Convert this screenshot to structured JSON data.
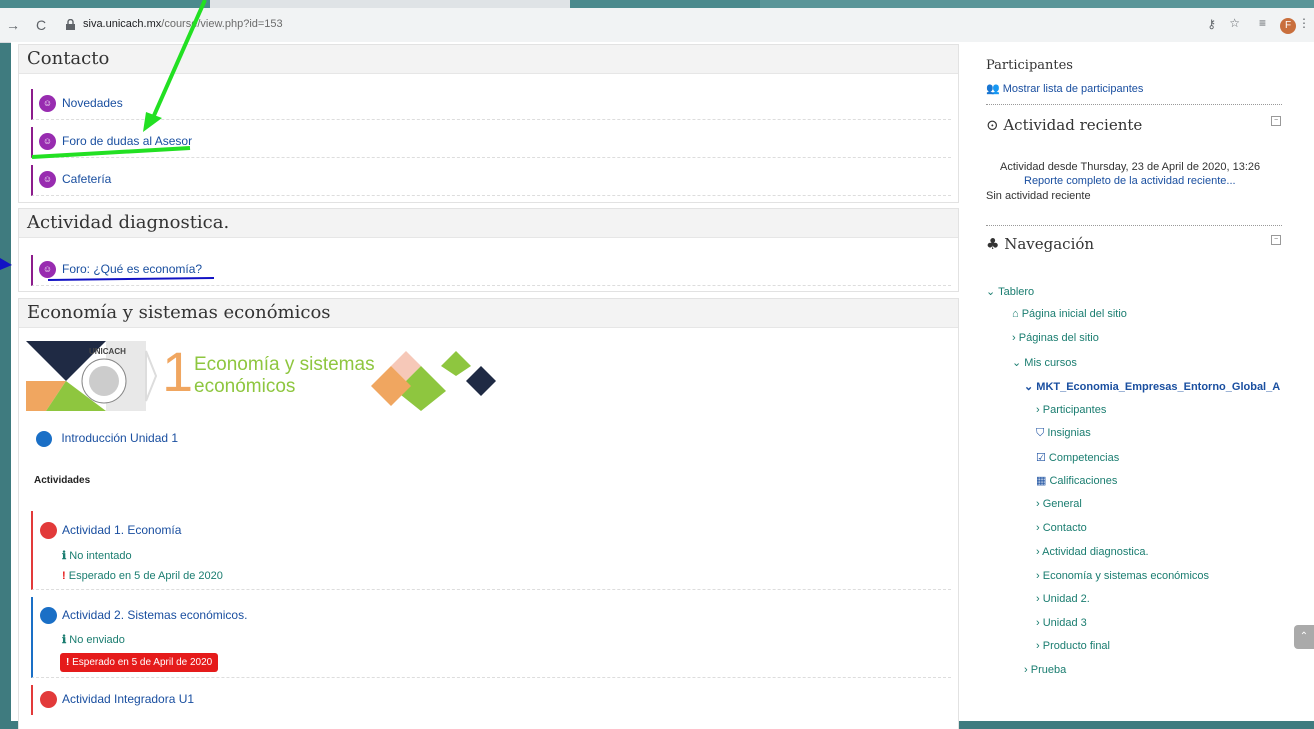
{
  "browser": {
    "url_host": "siva.unicach.mx",
    "url_path": "/course/view.php?id=153",
    "avatar_letter": "F"
  },
  "sections": {
    "contacto": {
      "title": "Contacto",
      "items": [
        "Novedades",
        "Foro de dudas al Asesor",
        "Cafetería"
      ]
    },
    "diagnostica": {
      "title": "Actividad diagnostica.",
      "items": [
        "Foro: ¿Qué es economía?"
      ]
    },
    "economia": {
      "title": "Economía y sistemas económicos",
      "banner": {
        "number": "1",
        "line1": "Economía y sistemas",
        "line2": "económicos",
        "seal_text": "UNICACH"
      },
      "intro_label": "Introducción Unidad 1",
      "activities_heading": "Actividades",
      "act1": {
        "label": "Actividad 1. Economía",
        "status": "No intentado",
        "due": "Esperado en 5 de April de 2020"
      },
      "act2": {
        "label": "Actividad 2. Sistemas económicos.",
        "status": "No enviado",
        "due": "Esperado en 5 de April de 2020"
      },
      "act3": {
        "label": "Actividad Integradora U1"
      }
    }
  },
  "sidebar": {
    "participantes": {
      "title": "Participantes",
      "link": "Mostrar lista de participantes"
    },
    "actividad": {
      "title": "Actividad reciente",
      "since": "Actividad desde Thursday, 23 de April de 2020, 13:26",
      "report_link": "Reporte completo de la actividad reciente...",
      "none": "Sin actividad reciente"
    },
    "navegacion": {
      "title": "Navegación",
      "tablero": "Tablero",
      "pagina_inicial": "Página inicial del sitio",
      "paginas_sitio": "Páginas del sitio",
      "mis_cursos": "Mis cursos",
      "course": "MKT_Economia_Empresas_Entorno_Global_A",
      "participantes": "Participantes",
      "insignias": "Insignias",
      "competencias": "Competencias",
      "calificaciones": "Calificaciones",
      "general": "General",
      "contacto": "Contacto",
      "actividad_diag": "Actividad diagnostica.",
      "economia": "Economía y sistemas económicos",
      "unidad2": "Unidad 2.",
      "unidad3": "Unidad 3",
      "producto": "Producto final",
      "prueba": "Prueba"
    }
  },
  "colors": {
    "forum_icon": "#982cb0",
    "link": "#1a4fa0",
    "teal": "#1a7d70",
    "alert": "#e51b1b",
    "annotation_green": "#22e022",
    "annotation_blue": "#1212c4"
  }
}
